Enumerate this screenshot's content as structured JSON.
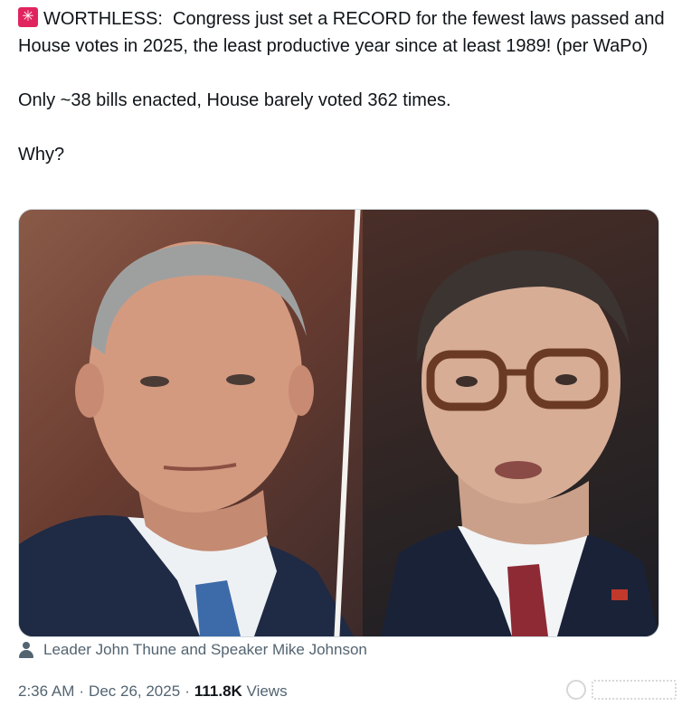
{
  "post": {
    "line1_tag": "WORTHLESS:",
    "line1_text": "Congress just set a RECORD for the fewest laws passed and House votes in 2025, the least productive year since at least 1989! (per WaPo)",
    "line2": "Only ~38 bills enacted, House barely voted 362 times.",
    "line3": "Why?",
    "emoji": "siren-icon"
  },
  "media": {
    "caption": "Leader John Thune and Speaker Mike Johnson",
    "caption_icon": "person-icon"
  },
  "meta": {
    "time": "2:36 AM",
    "separator": "·",
    "date": "Dec 26, 2025",
    "views_count": "111.8K",
    "views_label": "Views"
  },
  "colors": {
    "text": "#0f1419",
    "secondary": "#536471",
    "border": "#cfd9de"
  }
}
